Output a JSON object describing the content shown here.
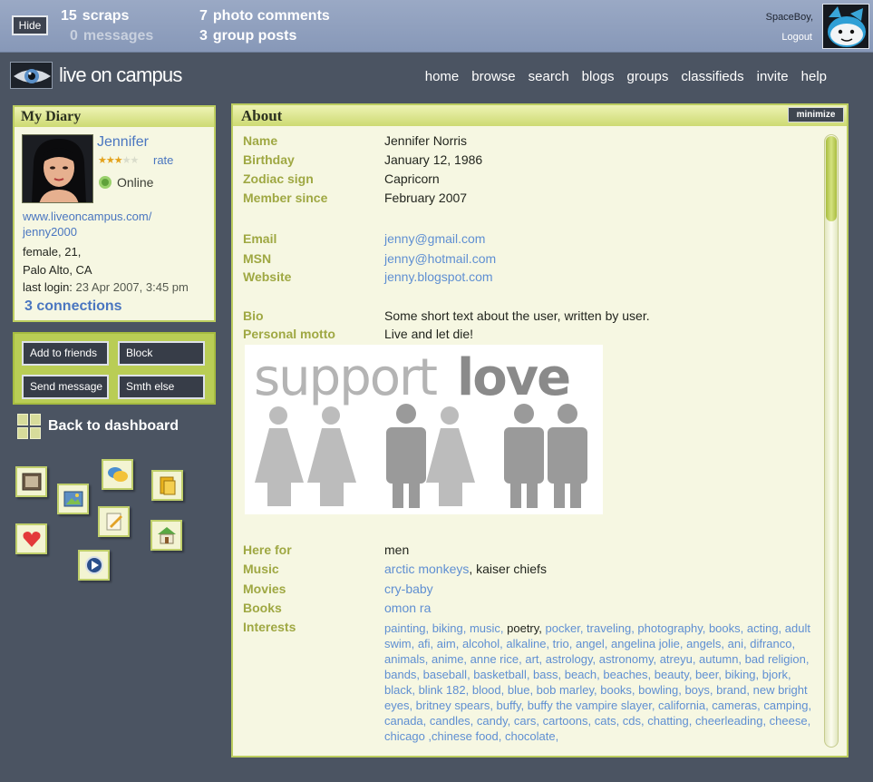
{
  "topbar": {
    "hide_label": "Hide",
    "scraps_count": "15",
    "scraps_label": "scraps",
    "messages_count": "0",
    "messages_label": "messages",
    "photo_comments_count": "7",
    "photo_comments_label": "photo comments",
    "group_posts_count": "3",
    "group_posts_label": "group posts",
    "user_name": "SpaceBoy,",
    "logout_label": "Logout"
  },
  "header": {
    "logo_text": "live on campus",
    "nav": [
      "home",
      "browse",
      "search",
      "blogs",
      "groups",
      "classifieds",
      "invite",
      "help"
    ]
  },
  "diary": {
    "title": "My Diary",
    "name": "Jennifer",
    "rating_stars": "★★★★★",
    "rating_filled": 3,
    "rating_max": 5,
    "rate_label": "rate",
    "status": "Online",
    "url_line1": "www.liveoncampus.com/",
    "url_line2": "jenny2000",
    "gender_age": "female, 21,",
    "location": "Palo Alto, CA",
    "last_login_label": "last login:",
    "last_login_value": "23 Apr 2007, 3:45 pm",
    "connections": "3 connections"
  },
  "actions": {
    "add_friends": "Add to friends",
    "block": "Block",
    "send_message": "Send message",
    "smth_else": "Smth else"
  },
  "dashboard": {
    "back_label": "Back to dashboard"
  },
  "about": {
    "title": "About",
    "minimize_label": "minimize",
    "fields": {
      "name_label": "Name",
      "name": "Jennifer Norris",
      "birthday_label": "Birthday",
      "birthday": "January 12, 1986",
      "zodiac_label": "Zodiac sign",
      "zodiac": "Capricorn",
      "member_label": "Member since",
      "member": "February 2007",
      "email_label": "Email",
      "email": "jenny@gmail.com",
      "msn_label": "MSN",
      "msn": "jenny@hotmail.com",
      "website_label": "Website",
      "website": "jenny.blogspot.com",
      "bio_label": "Bio",
      "bio": "Some short text about the user, written by user.",
      "motto_label": "Personal motto",
      "motto": "Live and let die!",
      "here_for_label": "Here for",
      "here_for": "men",
      "music_label": "Music",
      "music_link": "arctic monkeys",
      "music_rest": ", kaiser chiefs",
      "movies_label": "Movies",
      "movies": "cry-baby",
      "books_label": "Books",
      "books": "omon ra",
      "interests_label": "Interests"
    },
    "image_text_support": "support",
    "image_text_love": "love",
    "interests_links_a": "painting, biking, music,",
    "interests_plain": " poetry, ",
    "interests_links_b": "pocker, traveling, photography, books, acting, adult swim, afi, aim, alcohol, alkaline, trio, angel, angelina jolie, angels, ani, difranco, animals, anime, anne rice, art, astrology, astronomy, atreyu, autumn, bad religion, bands, baseball, basketball, bass, beach, beaches, beauty, beer, biking, bjork, black, blink 182, blood, blue, bob marley, books, bowling, boys, brand, new bright eyes, britney spears, buffy, buffy the vampire slayer, california, cameras, camping, canada, candles, candy, cars, cartoons, cats, cds, chatting, cheerleading, cheese, chicago ,chinese food, chocolate,"
  },
  "colors": {
    "accent_green": "#bccd5f",
    "label_olive": "#9fa843",
    "link_blue": "#5f8fd2",
    "background": "#4b5462"
  }
}
